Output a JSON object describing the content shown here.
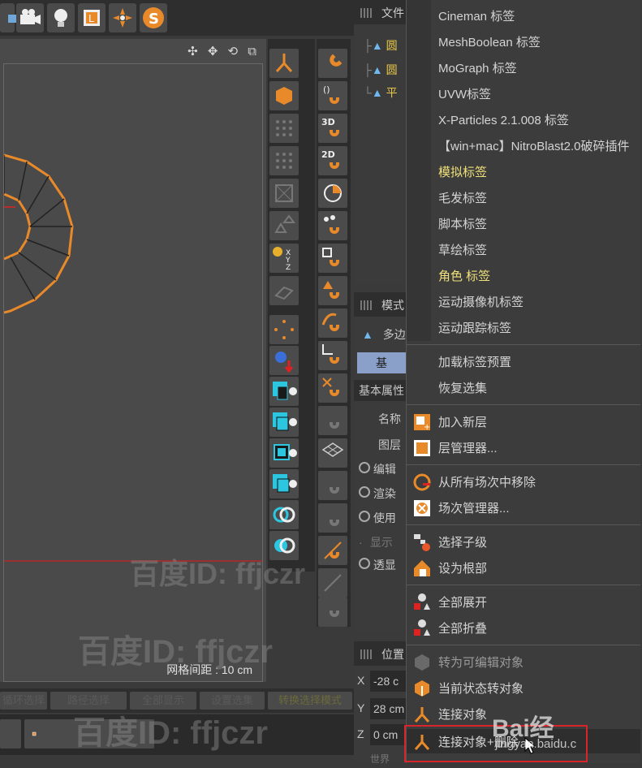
{
  "viewport": {
    "grid_spacing_label": "网格间距 : 10 cm",
    "nav_icons": "✣ ✥ ⟲ ⧉"
  },
  "bottom_toolbar": {
    "buttons": [
      "循环选择",
      "路径选择",
      "全部显示",
      "设置选集",
      "转换选择模式"
    ]
  },
  "object_panel": {
    "header": "文件",
    "objects": [
      "圆",
      "圆",
      "平"
    ]
  },
  "attribute_panel": {
    "header": "模式",
    "object_type": "多边",
    "tab": "基",
    "section": "基本属性",
    "fields": [
      "名称",
      "图层"
    ],
    "options": [
      "编辑",
      "渲染",
      "使用",
      "显示",
      "透显"
    ]
  },
  "coord_panel": {
    "header": "位置",
    "axes": [
      {
        "axis": "X",
        "value": "-28 c"
      },
      {
        "axis": "Y",
        "value": "28 cm"
      },
      {
        "axis": "Z",
        "value": "0 cm"
      }
    ],
    "footer": "世界"
  },
  "context_menu": {
    "tag_items": [
      {
        "label": "Cineman 标签",
        "style": "normal"
      },
      {
        "label": "MeshBoolean 标签",
        "style": "normal"
      },
      {
        "label": "MoGraph 标签",
        "style": "normal"
      },
      {
        "label": "UVW标签",
        "style": "normal"
      },
      {
        "label": "X-Particles 2.1.008 标签",
        "style": "normal"
      },
      {
        "label": "【win+mac】NitroBlast2.0破碎插件",
        "style": "normal"
      },
      {
        "label": "模拟标签",
        "style": "yellow"
      },
      {
        "label": "毛发标签",
        "style": "normal"
      },
      {
        "label": "脚本标签",
        "style": "normal"
      },
      {
        "label": "草绘标签",
        "style": "normal"
      },
      {
        "label": "角色 标签",
        "style": "yellow"
      },
      {
        "label": "运动摄像机标签",
        "style": "normal"
      },
      {
        "label": "运动跟踪标签",
        "style": "normal"
      }
    ],
    "preset_items": [
      "加载标签预置",
      "恢复选集"
    ],
    "layer_items": [
      "加入新层",
      "层管理器..."
    ],
    "take_items": [
      "从所有场次中移除",
      "场次管理器..."
    ],
    "hierarchy_items": [
      "选择子级",
      "设为根部"
    ],
    "expand_items": [
      "全部展开",
      "全部折叠"
    ],
    "convert_items": [
      "转为可编辑对象",
      "当前状态转对象",
      "连接对象",
      "连接对象+删除"
    ]
  },
  "watermarks": {
    "baidu_id": "百度ID: ffjczr",
    "baidu_logo": "Bai经",
    "jingyan_url": "jingyan.baidu.c"
  },
  "colors": {
    "accent_orange": "#e8892a",
    "highlight_red": "#d8242a",
    "menu_yellow": "#f0e07a",
    "viewport_bg": "#4a4a4a"
  }
}
